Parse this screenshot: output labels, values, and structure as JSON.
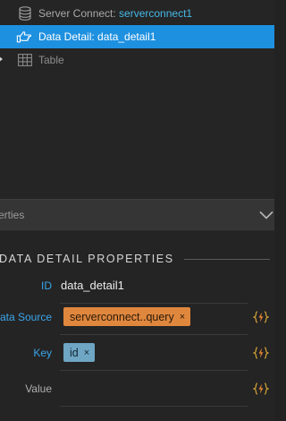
{
  "tree": {
    "server_connect": {
      "label": "Server Connect: ",
      "value": "serverconnect1",
      "icon": "database-icon"
    },
    "data_detail": {
      "label": "Data Detail: data_detail1",
      "icon": "pointing-hand-icon",
      "selected_color": "#1e90e0"
    },
    "table": {
      "label": "Table",
      "icon": "table-grid-icon"
    }
  },
  "panel": {
    "title": "erties",
    "collapse_icon": "chevron-down-icon"
  },
  "properties": {
    "section_title": "DATA DETAIL PROPERTIES",
    "id": {
      "label": "ID",
      "value": "data_detail1"
    },
    "data_source": {
      "label": "ata Source",
      "chip": "serverconnect..query",
      "chip_remove": "×",
      "chip_color": "#e0873e"
    },
    "key": {
      "label": "Key",
      "chip": "id",
      "chip_remove": "×",
      "chip_color": "#6ea6c4"
    },
    "value": {
      "label": "Value"
    },
    "dynamic_icon": "lightning-bolt-braces-icon",
    "accent_color": "#3aa6ec"
  }
}
